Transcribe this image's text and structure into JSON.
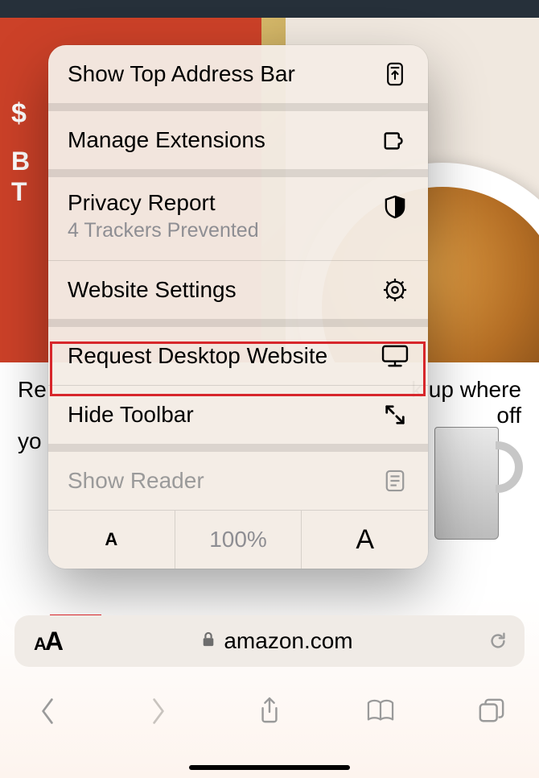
{
  "page": {
    "keep_shopping_header": "Re... k up where yo...                    off"
  },
  "menu": {
    "show_top_bar": "Show Top Address Bar",
    "manage_ext": "Manage Extensions",
    "privacy_title": "Privacy Report",
    "privacy_sub": "4 Trackers Prevented",
    "site_settings": "Website Settings",
    "request_desktop": "Request Desktop Website",
    "hide_toolbar": "Hide Toolbar",
    "show_reader": "Show Reader",
    "zoom_dec_glyph": "A",
    "zoom_pct": "100%",
    "zoom_inc_glyph": "A"
  },
  "address": {
    "aa_small": "A",
    "aa_large": "A",
    "domain": "amazon.com"
  },
  "bg": {
    "dollar": "$",
    "b": "B",
    "t": "T",
    "card_text_left": "Re",
    "card_text_right_a": "k up where",
    "card_text_right_b": "off",
    "card_yo": "yo"
  }
}
